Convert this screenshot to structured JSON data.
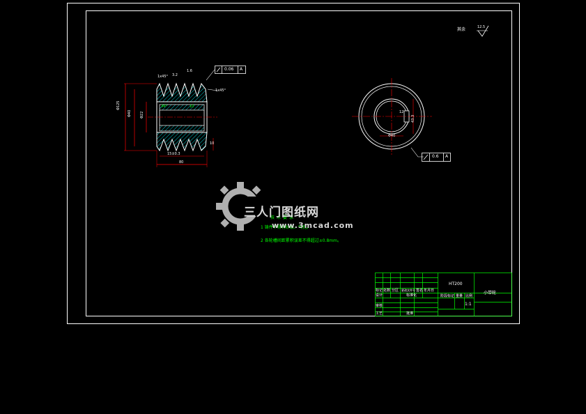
{
  "drawing": {
    "surface_note": "其余",
    "roughness_value": "12.5",
    "part_name": "小带轮",
    "material": "HT200",
    "scale": "1:1"
  },
  "tolerances": {
    "runout_left": "0.06",
    "datum_left": "A",
    "runout_right": "0.6",
    "datum_right": "A"
  },
  "front_view_labels": {
    "bore_dim": "Φ40",
    "outer_dim": "Φ125",
    "hub_dim": "Φ22",
    "width_dim": "80",
    "groove_pitch": "15±0.3",
    "groove_edge": "10",
    "groove_angle": "34°",
    "chamfer_top": "1x45°",
    "chamfer_right": "1x45°",
    "roughness_a": "3.2",
    "roughness_b": "1.6"
  },
  "side_view_labels": {
    "keyway_depth": "43.3",
    "keyway_width": "12",
    "bore_label": "Φ40"
  },
  "tech_requirements": {
    "title": "技术要求",
    "items": [
      "1 铸件不得有砂眼、气孔。",
      "2 各轮槽间距累积误差不得超过±0.8mm。"
    ]
  },
  "title_block": {
    "header_row": [
      "标记",
      "处数",
      "分区",
      "更改文件号",
      "签名",
      "年月日"
    ],
    "designer": "设计",
    "checker": "审核",
    "process": "工艺",
    "standard": "标准化",
    "approve": "批准",
    "stage_mark": "阶段标记",
    "weight": "重量",
    "scale_label": "比例"
  },
  "watermark": {
    "brand": "三人门图纸网",
    "url": "www.3mcad.com"
  },
  "colors": {
    "frame": "#ffffff",
    "geometry": "#ffffff",
    "dimension": "#ff0000",
    "text_green": "#00ff00",
    "hatch": "#00ffff",
    "title_block": "#00ff00"
  }
}
